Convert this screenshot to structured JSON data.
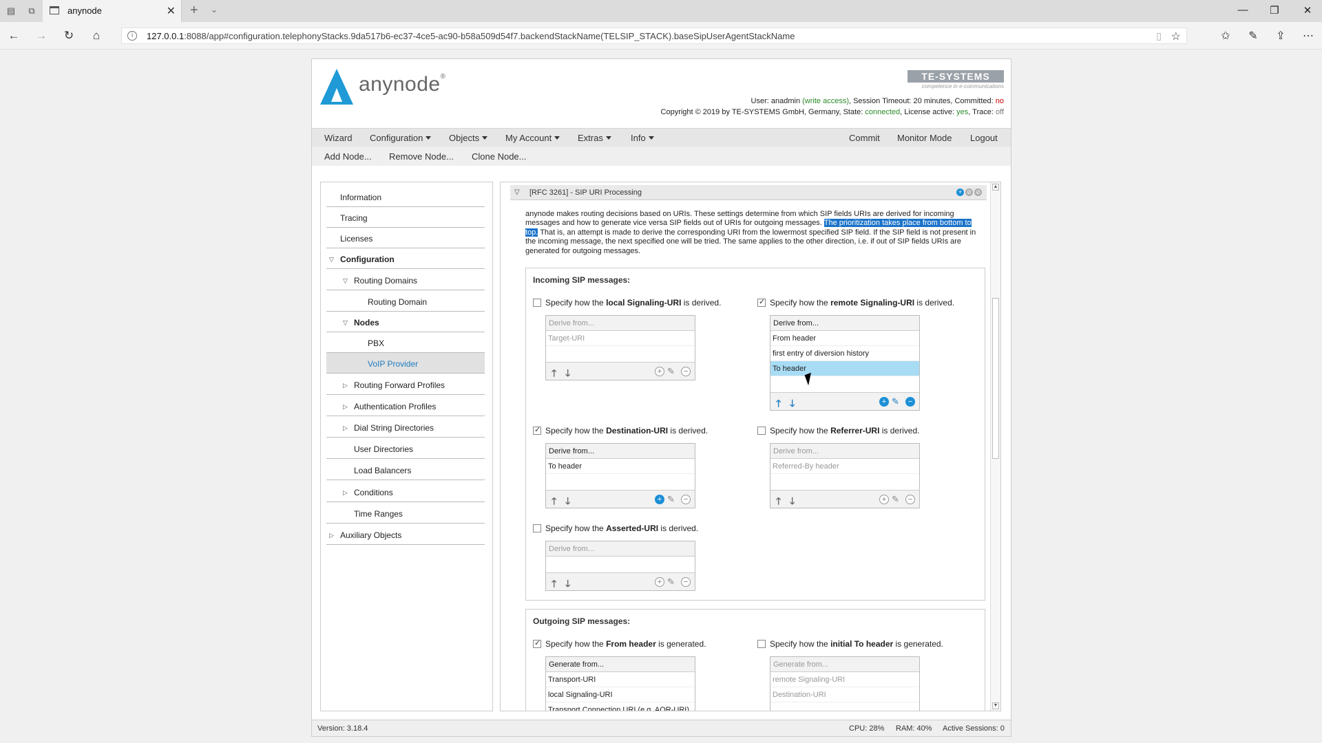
{
  "browser": {
    "tab_title": "anynode",
    "url_host": "127.0.0.1",
    "url_rest": ":8088/app#configuration.telephonyStacks.9da517b6-ec37-4ce5-ac90-b58a509d54f7.backendStackName(TELSIP_STACK).baseSipUserAgentStackName"
  },
  "header": {
    "brand": "anynode",
    "reg": "®",
    "company": "TE-SYSTEMS",
    "company_sub": "competence in e-communications",
    "user_prefix": "User: ",
    "user": "anadmin",
    "access": "(write access)",
    "session": ", Session Timeout: 20 minutes, Committed: ",
    "committed": "no",
    "copyright_prefix": "Copyright © 2019 by TE-SYSTEMS GmbH, Germany, State: ",
    "state": "connected",
    "license_label": ", License active: ",
    "license": "yes",
    "trace_label": ", Trace: ",
    "trace": "off"
  },
  "menu": {
    "wizard": "Wizard",
    "configuration": "Configuration",
    "objects": "Objects",
    "my_account": "My Account",
    "extras": "Extras",
    "info": "Info",
    "commit": "Commit",
    "monitor": "Monitor Mode",
    "logout": "Logout",
    "add_node": "Add Node...",
    "remove_node": "Remove Node...",
    "clone_node": "Clone Node..."
  },
  "sidebar": {
    "items": [
      {
        "label": "Information"
      },
      {
        "label": "Tracing"
      },
      {
        "label": "Licenses"
      },
      {
        "label": "Configuration"
      },
      {
        "label": "Routing Domains"
      },
      {
        "label": "Routing Domain"
      },
      {
        "label": "Nodes"
      },
      {
        "label": "PBX"
      },
      {
        "label": "VoIP Provider"
      },
      {
        "label": "Routing Forward Profiles"
      },
      {
        "label": "Authentication Profiles"
      },
      {
        "label": "Dial String Directories"
      },
      {
        "label": "User Directories"
      },
      {
        "label": "Load Balancers"
      },
      {
        "label": "Conditions"
      },
      {
        "label": "Time Ranges"
      },
      {
        "label": "Auxiliary Objects"
      }
    ]
  },
  "section": {
    "title": "[RFC 3261] - SIP URI Processing",
    "para1": "anynode makes routing decisions based on URIs. These settings determine from which SIP fields URIs are derived for incoming messages and how to generate vice versa SIP fields out of URIs for outgoing messages. ",
    "para_hl": "The prioritization takes place from bottom to top.",
    "para2": " That is, an attempt is made to derive the corresponding URI from the lowermost specified SIP field. If the SIP field is not present in the incoming message, the next specified one will be tried. The same applies to the other direction, i.e. if out of SIP fields URIs are generated for outgoing messages."
  },
  "incoming": {
    "title": "Incoming SIP messages:",
    "local": {
      "pre": "Specify how the ",
      "b": "local Signaling-URI",
      "post": " is derived.",
      "header": "Derive from...",
      "rows": [
        "Target-URI"
      ]
    },
    "remote": {
      "pre": "Specify how the ",
      "b": "remote Signaling-URI",
      "post": " is derived.",
      "header": "Derive from...",
      "rows": [
        "From header",
        "first entry of diversion history",
        "To header"
      ]
    },
    "destination": {
      "pre": "Specify how the ",
      "b": "Destination-URI",
      "post": " is derived.",
      "header": "Derive from...",
      "rows": [
        "To header"
      ]
    },
    "referrer": {
      "pre": "Specify how the ",
      "b": "Referrer-URI",
      "post": " is derived.",
      "header": "Derive from...",
      "rows": [
        "Referred-By header"
      ]
    },
    "asserted": {
      "pre": "Specify how the ",
      "b": "Asserted-URI",
      "post": " is derived.",
      "header": "Derive from...",
      "rows": []
    }
  },
  "outgoing": {
    "title": "Outgoing SIP messages:",
    "from": {
      "pre": "Specify how the ",
      "b": "From header",
      "post": " is generated.",
      "header": "Generate from...",
      "rows": [
        "Transport-URI",
        "local Signaling-URI",
        "Transport Connection URI (e.g. AOR-URI)"
      ]
    },
    "to": {
      "pre": "Specify how the ",
      "b": "initial To header",
      "post": " is generated.",
      "header": "Generate from...",
      "rows": [
        "remote Signaling-URI",
        "Destination-URI"
      ]
    }
  },
  "status": {
    "version": "Version: 3.18.4",
    "cpu": "CPU: 28%",
    "ram": "RAM: 40%",
    "sessions": "Active Sessions: 0"
  }
}
